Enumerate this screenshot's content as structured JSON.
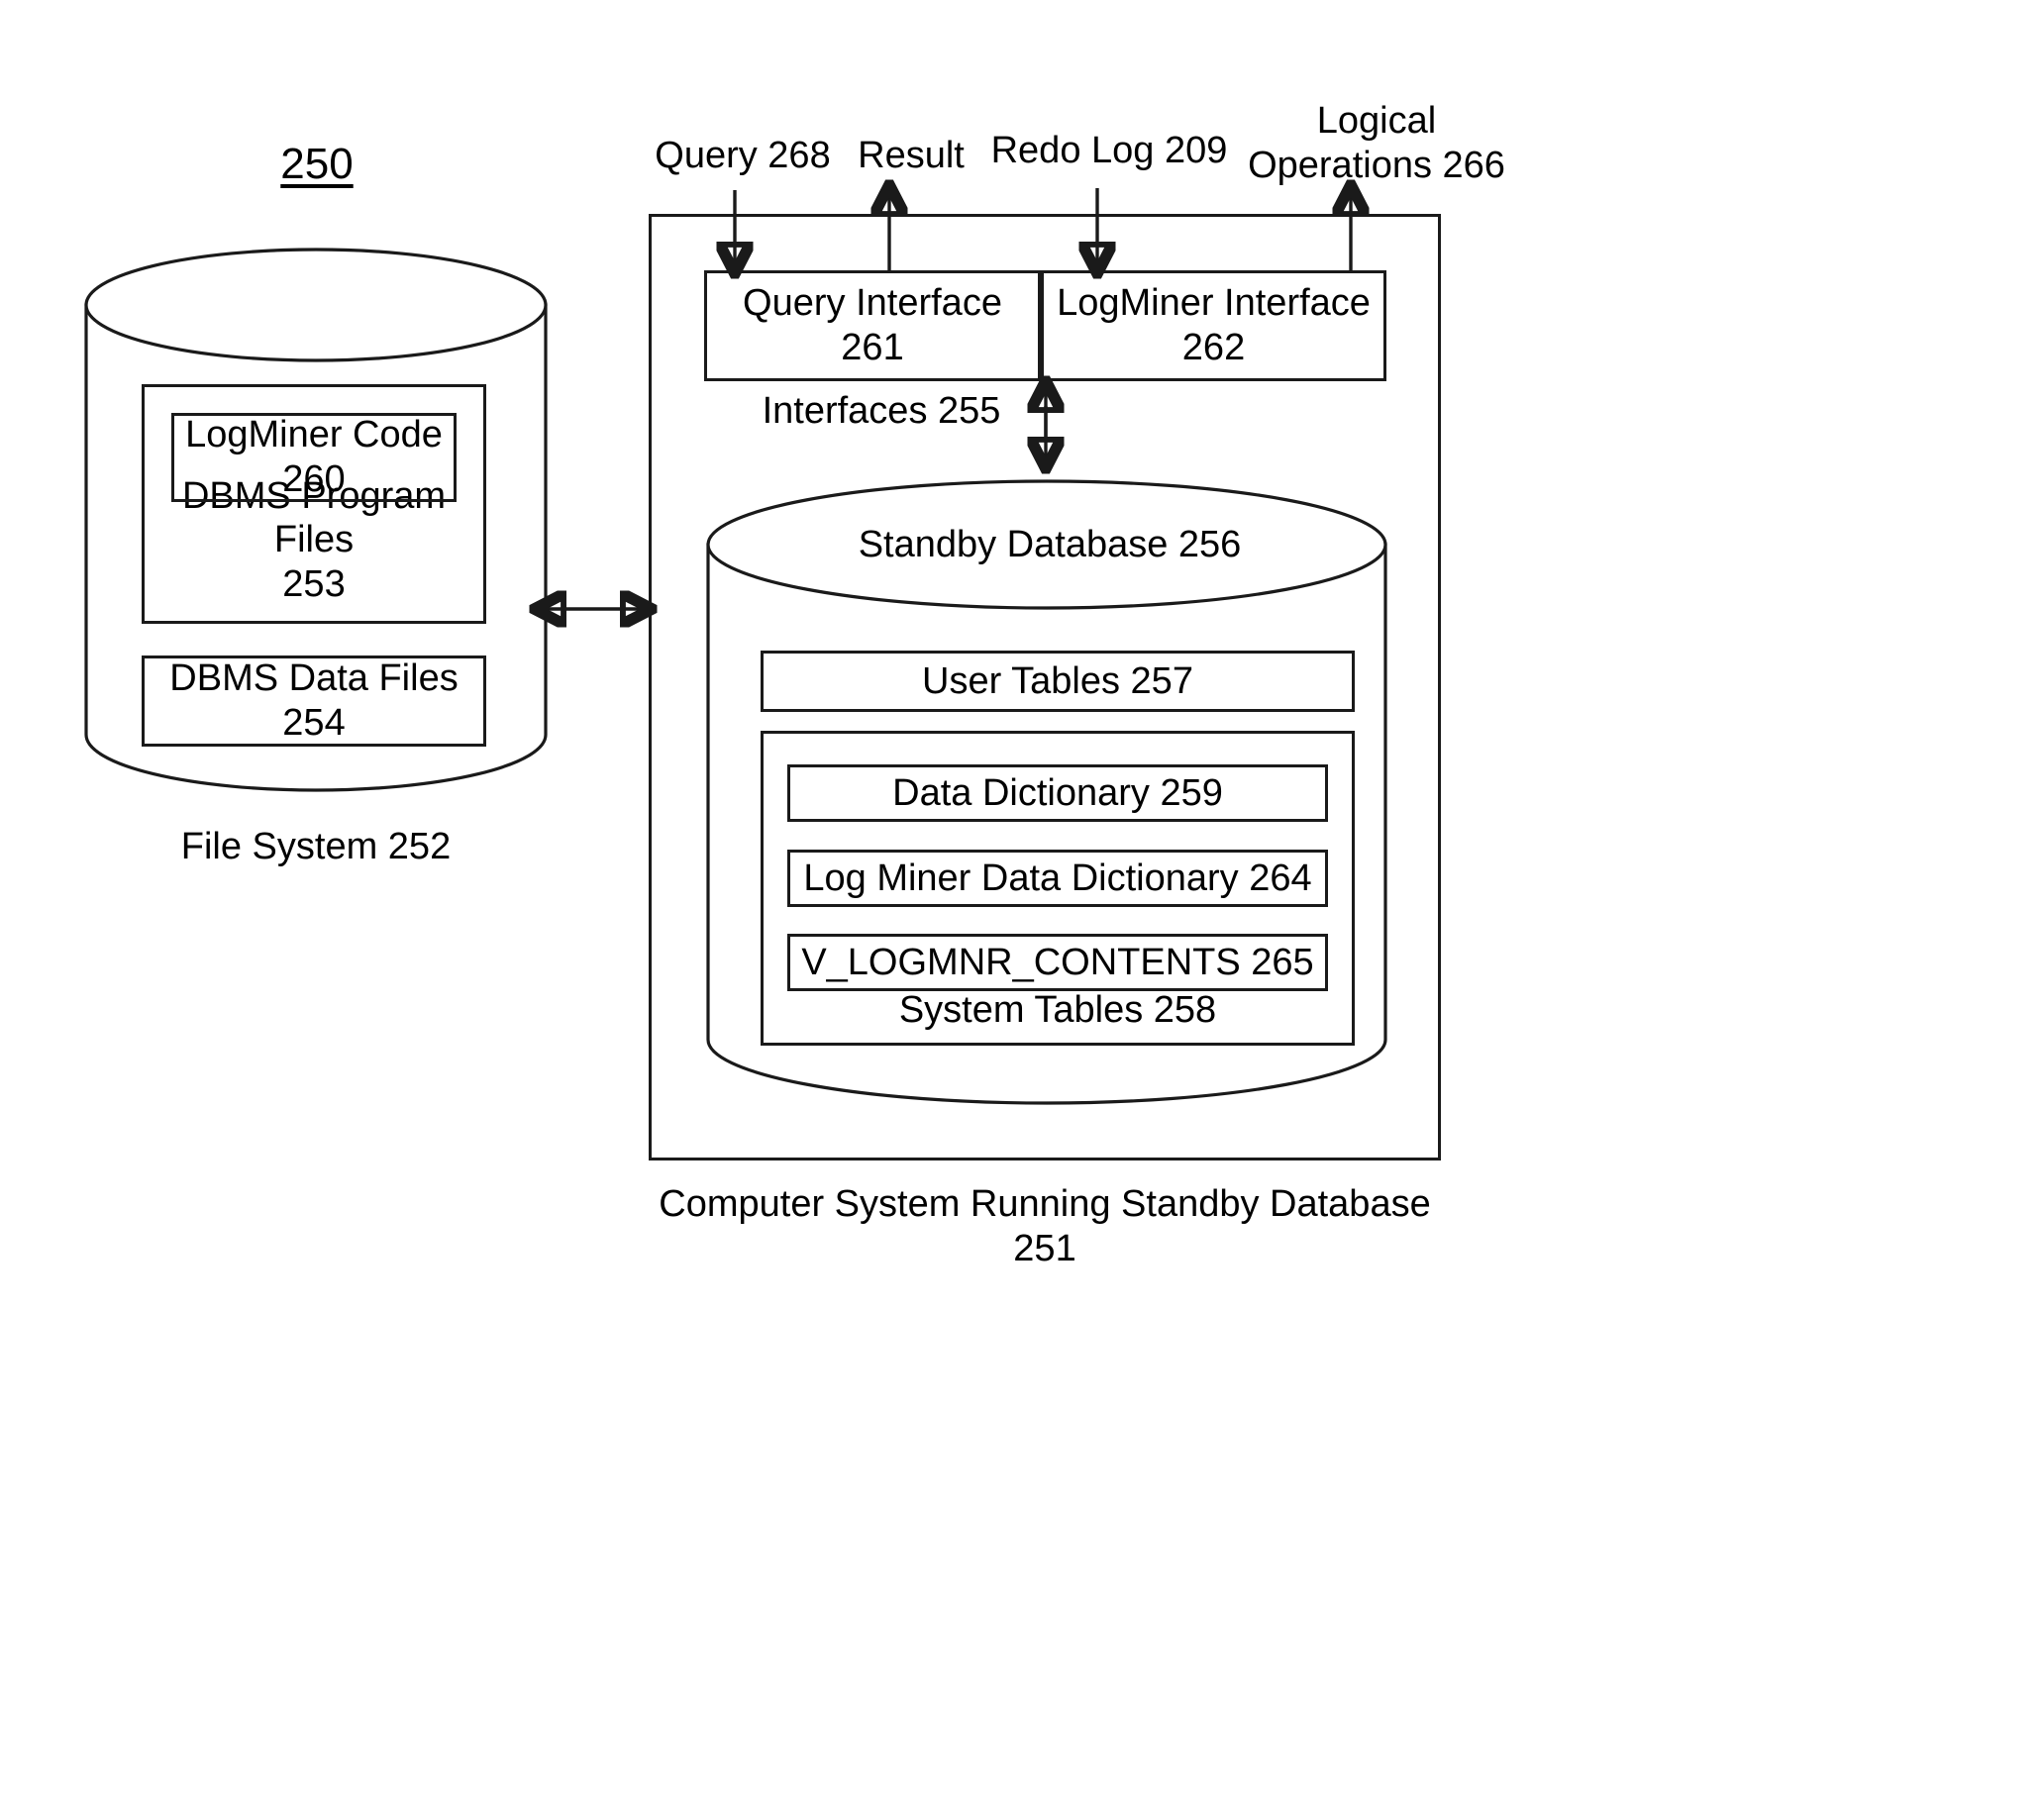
{
  "figure": {
    "number": "250",
    "caption_left": "File System 252",
    "caption_right": "Computer System Running Standby Database 251"
  },
  "flow_labels": {
    "query": "Query 268",
    "result": "Result",
    "redo_log": "Redo Log 209",
    "logical_operations": "Logical\nOperations 266"
  },
  "file_system": {
    "program_files": "DBMS Program Files\n253",
    "logminer_code": "LogMiner Code\n260",
    "data_files": "DBMS Data Files 254"
  },
  "interfaces": {
    "group_label": "Interfaces 255",
    "query_interface": "Query Interface 261",
    "logminer_interface": "LogMiner Interface\n262"
  },
  "standby_database": {
    "title": "Standby Database 256",
    "user_tables": "User Tables 257",
    "system_tables_label": "System Tables 258",
    "system_tables": [
      "Data Dictionary 259",
      "Log Miner Data Dictionary 264",
      "V_LOGMNR_CONTENTS 265"
    ]
  },
  "colors": {
    "stroke": "#1a1a1a",
    "background": "#ffffff"
  }
}
